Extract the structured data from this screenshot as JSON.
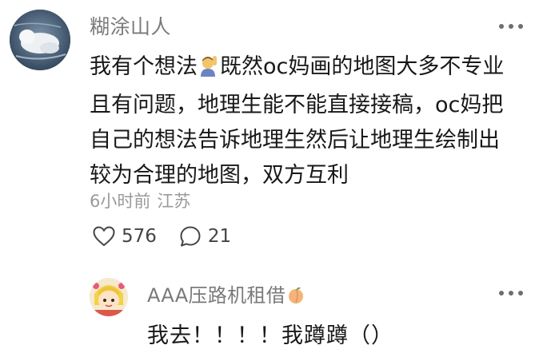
{
  "comment": {
    "username": "糊涂山人",
    "lines": [
      "我有个想法",
      "既然oc妈画的地图大多不专业",
      "且有问题，地理生能不能直接接稿，oc妈把",
      "自己的想法告诉地理生然后让地理生绘制出",
      "较为合理的地图，双方互利"
    ],
    "emoji_icon": "person-raising-hand-emoji",
    "time": "6小时前",
    "location": "江苏",
    "likes": "576",
    "replies": "21"
  },
  "reply": {
    "username": "AAA压路机租借",
    "username_emoji": "peach-emoji",
    "text": "我去！！！！我蹲蹲（）"
  },
  "colors": {
    "username": "#7a7a7a",
    "text": "#181818",
    "meta": "#9a9a9a"
  }
}
